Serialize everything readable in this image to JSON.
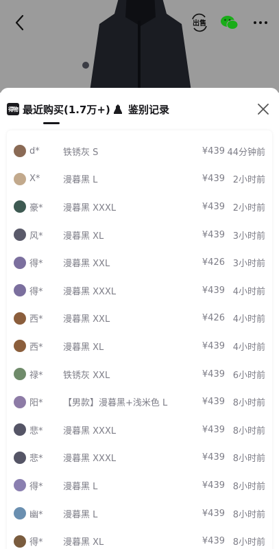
{
  "topbar": {
    "sell_label": "出售",
    "icons": [
      "back-icon",
      "sell-icon",
      "wechat-icon",
      "more-icon"
    ]
  },
  "tabs": [
    {
      "label": "最近购买(1.7万+)",
      "badge": "得物",
      "active": true
    },
    {
      "label": "鉴别记录",
      "active": false
    }
  ],
  "purchases": [
    {
      "buyer": "d*",
      "spec": "铁锈灰 S",
      "price": "¥439",
      "time": "44分钟前",
      "avatar_color": "#8a6a55"
    },
    {
      "buyer": "X*",
      "spec": "漫暮黑 L",
      "price": "¥439",
      "time": "2小时前",
      "avatar_color": "#c2a98c"
    },
    {
      "buyer": "豪*",
      "spec": "漫暮黑 XXXL",
      "price": "¥439",
      "time": "2小时前",
      "avatar_color": "#3e5a52"
    },
    {
      "buyer": "风*",
      "spec": "漫暮黑 XL",
      "price": "¥439",
      "time": "3小时前",
      "avatar_color": "#5a5a6a"
    },
    {
      "buyer": "得*",
      "spec": "漫暮黑 XXL",
      "price": "¥426",
      "time": "3小时前",
      "avatar_color": "#7b6f9e"
    },
    {
      "buyer": "得*",
      "spec": "漫暮黑 XXXL",
      "price": "¥439",
      "time": "4小时前",
      "avatar_color": "#7b6f9e"
    },
    {
      "buyer": "西*",
      "spec": "漫暮黑 XXL",
      "price": "¥426",
      "time": "4小时前",
      "avatar_color": "#8b5e3c"
    },
    {
      "buyer": "西*",
      "spec": "漫暮黑 XL",
      "price": "¥439",
      "time": "4小时前",
      "avatar_color": "#8b5e3c"
    },
    {
      "buyer": "禄*",
      "spec": "铁锈灰 XXL",
      "price": "¥439",
      "time": "6小时前",
      "avatar_color": "#6f8b6a"
    },
    {
      "buyer": "阳*",
      "spec": "【男款】漫暮黑+浅米色 L",
      "price": "¥439",
      "time": "8小时前",
      "avatar_color": "#8d7ba6"
    },
    {
      "buyer": "悲*",
      "spec": "漫暮黑 XXXL",
      "price": "¥439",
      "time": "8小时前",
      "avatar_color": "#555566"
    },
    {
      "buyer": "悲*",
      "spec": "漫暮黑 XXXL",
      "price": "¥439",
      "time": "8小时前",
      "avatar_color": "#555566"
    },
    {
      "buyer": "得*",
      "spec": "漫暮黑 L",
      "price": "¥439",
      "time": "8小时前",
      "avatar_color": "#8a7fb0"
    },
    {
      "buyer": "幽*",
      "spec": "漫暮黑 L",
      "price": "¥439",
      "time": "8小时前",
      "avatar_color": "#6a8fb0"
    },
    {
      "buyer": "得*",
      "spec": "漫暮黑 XL",
      "price": "¥439",
      "time": "8小时前",
      "avatar_color": "#7a5c3e"
    }
  ]
}
